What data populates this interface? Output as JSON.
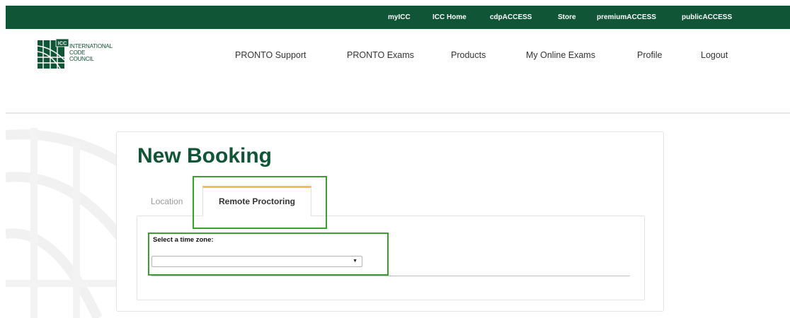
{
  "top_nav": {
    "links": [
      "myICC",
      "ICC Home",
      "cdpACCESS",
      "Store",
      "premiumACCESS",
      "publicACCESS"
    ]
  },
  "logo": {
    "mark_text": "ICC",
    "lines": [
      "INTERNATIONAL",
      "CODE",
      "COUNCIL"
    ]
  },
  "main_nav": {
    "links": [
      "PRONTO Support",
      "PRONTO Exams",
      "Products",
      "My Online Exams",
      "Profile",
      "Logout"
    ]
  },
  "booking": {
    "title": "New Booking",
    "tabs": [
      {
        "label": "Location",
        "active": false
      },
      {
        "label": "Remote Proctoring",
        "active": true
      }
    ],
    "timezone_label": "Select a time zone:",
    "timezone_value": ""
  },
  "colors": {
    "brand_green": "#0f5536",
    "highlight_green": "#3aa030",
    "tab_accent": "#f0c050"
  }
}
